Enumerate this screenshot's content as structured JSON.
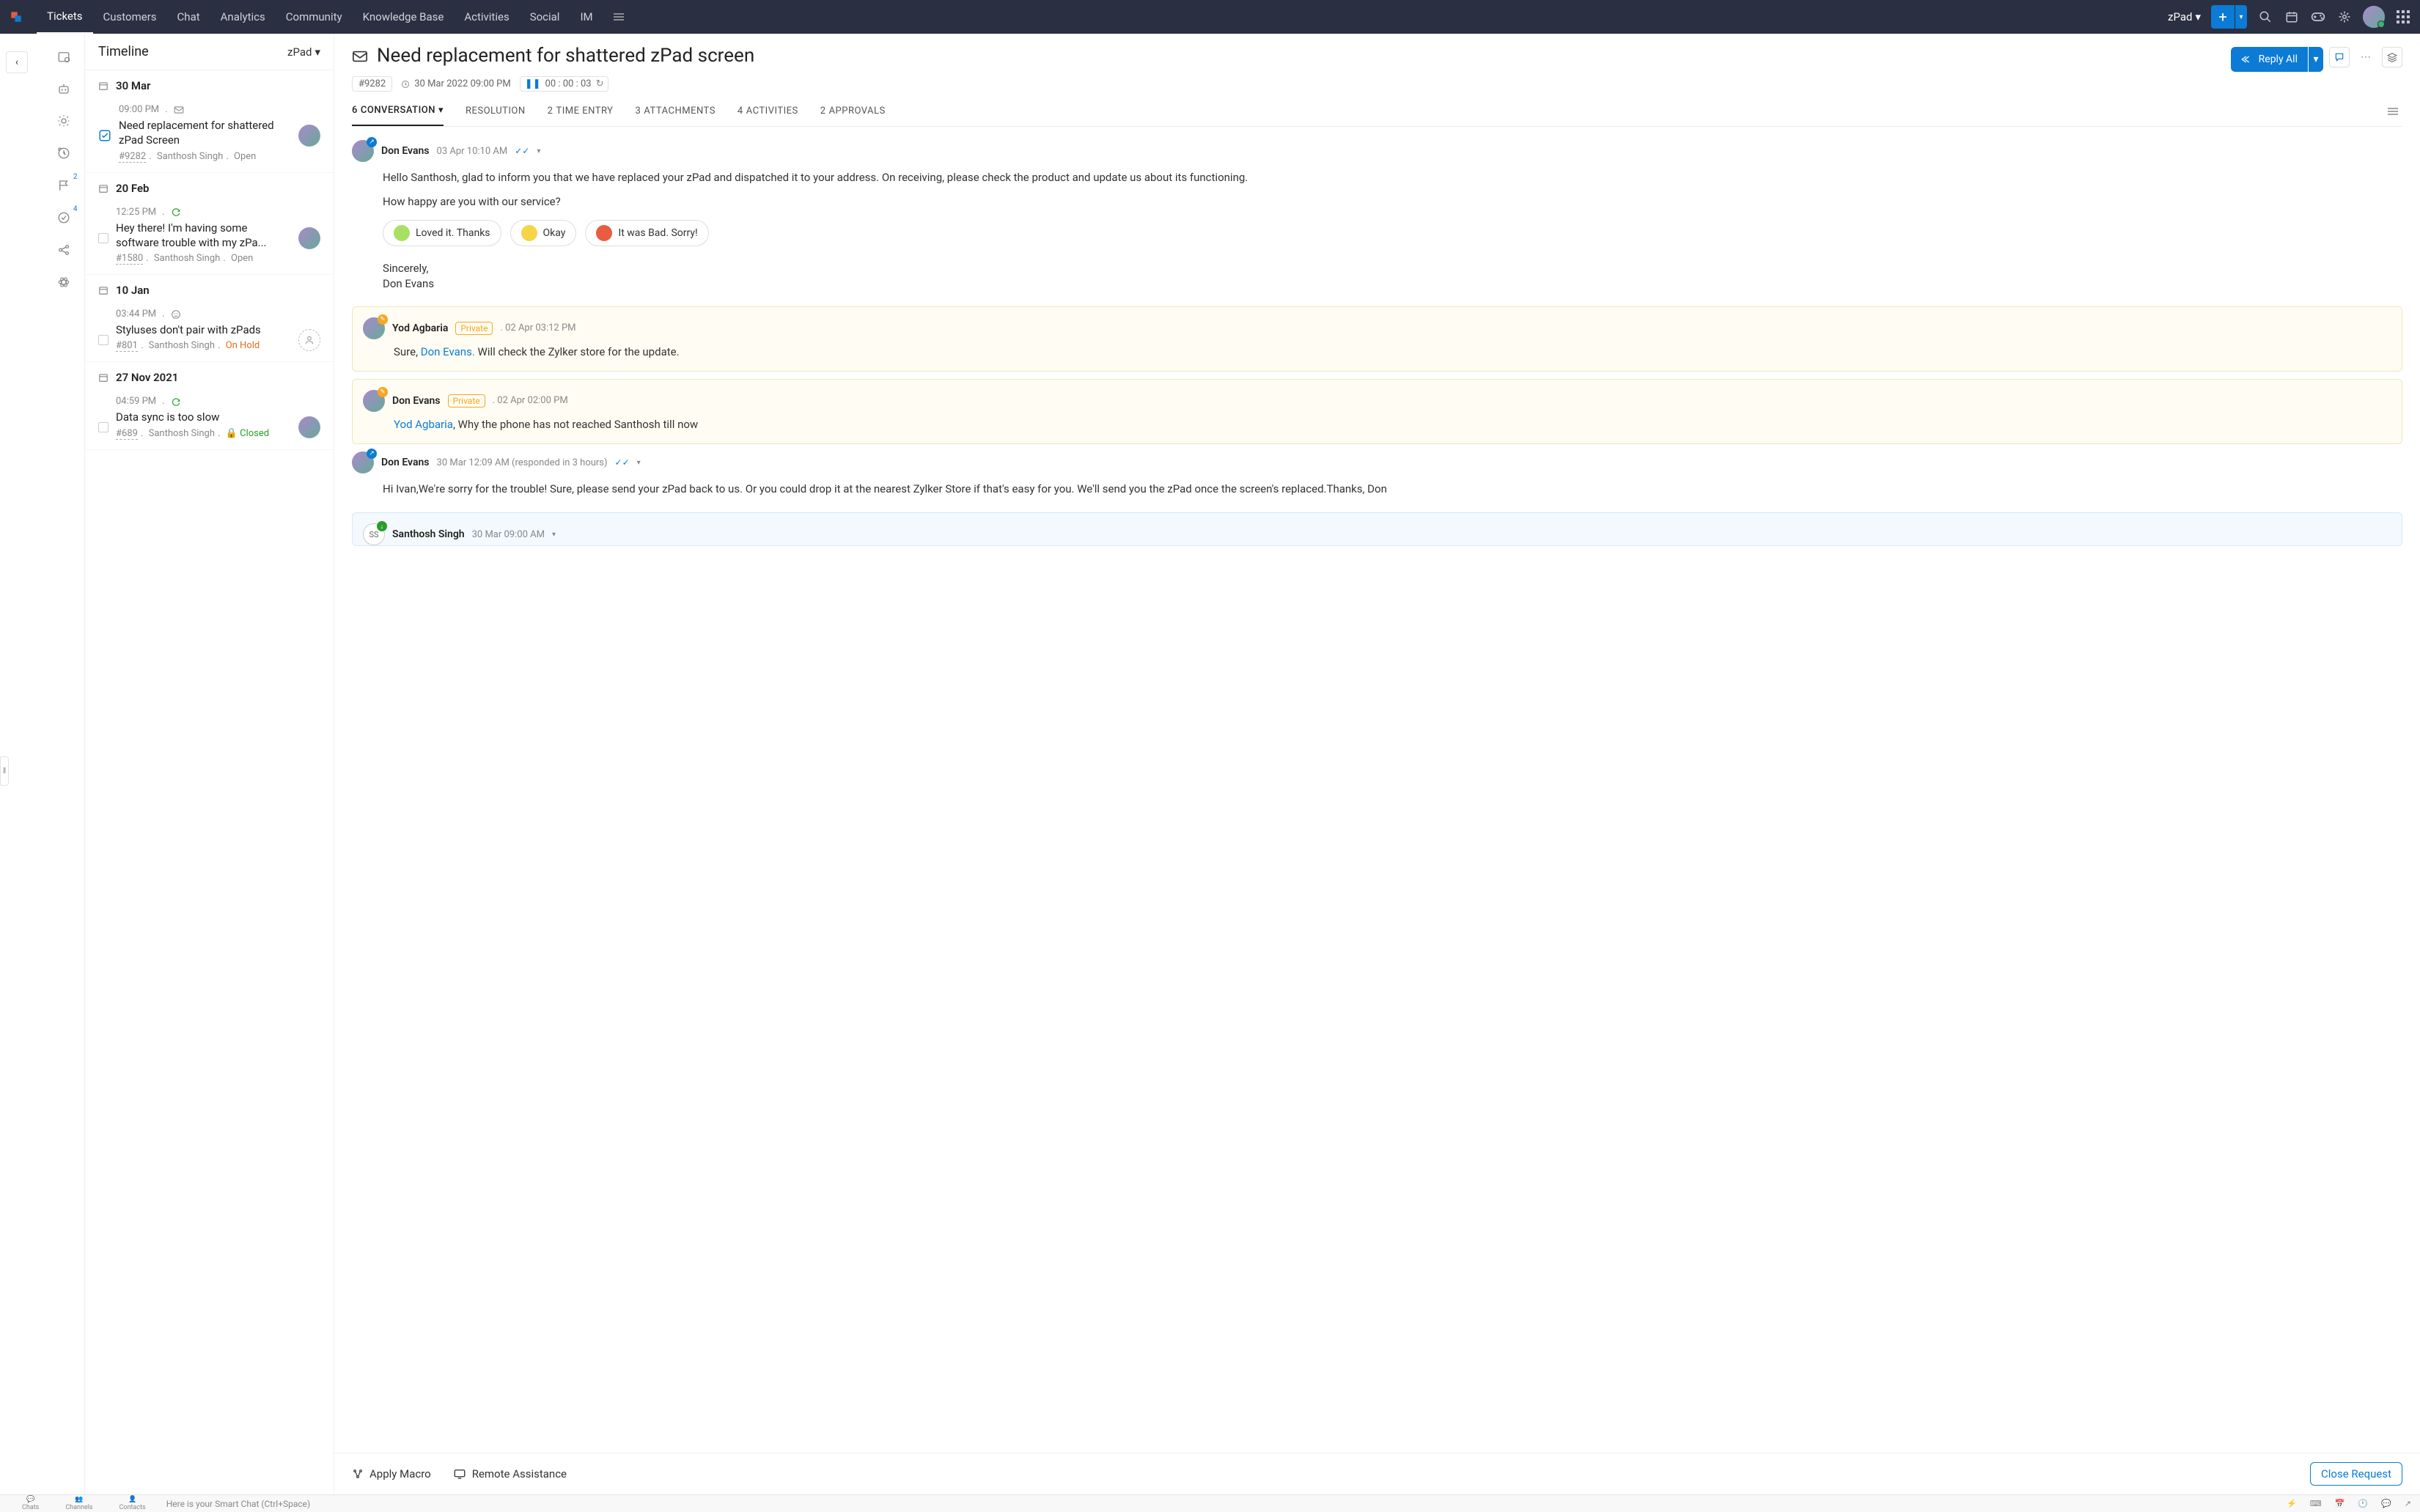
{
  "nav": {
    "items": [
      "Tickets",
      "Customers",
      "Chat",
      "Analytics",
      "Community",
      "Knowledge Base",
      "Activities",
      "Social",
      "IM"
    ],
    "brand": "zPad"
  },
  "timeline": {
    "title": "Timeline",
    "brand": "zPad",
    "groups": [
      {
        "date": "30 Mar",
        "tickets": [
          {
            "time": "09:00 PM",
            "subject": "Need replacement for shattered zPad Screen",
            "id": "#9282",
            "assignee": "Santhosh Singh",
            "status": "Open",
            "selected": true,
            "hasAvatar": true
          }
        ]
      },
      {
        "date": "20 Feb",
        "tickets": [
          {
            "time": "12:25 PM",
            "subject": "Hey there! I'm having some software trouble with my zPa...",
            "id": "#1580",
            "assignee": "Santhosh Singh",
            "status": "Open",
            "hasAvatar": true
          }
        ]
      },
      {
        "date": "10 Jan",
        "tickets": [
          {
            "time": "03:44 PM",
            "subject": "Styluses don't pair with zPads",
            "id": "#801",
            "assignee": "Santhosh Singh",
            "status": "On Hold",
            "statusClass": "onhold",
            "hasAvatar": false
          }
        ]
      },
      {
        "date": "27 Nov 2021",
        "tickets": [
          {
            "time": "04:59 PM",
            "subject": "Data sync is too slow",
            "id": "#689",
            "assignee": "Santhosh Singh",
            "status": "Closed",
            "statusClass": "closed",
            "closedIcon": true,
            "hasAvatar": true
          }
        ]
      }
    ]
  },
  "iconrail": {
    "badge1": "2",
    "badge2": "4"
  },
  "ticket": {
    "title": "Need replacement for shattered zPad screen",
    "id": "#9282",
    "date": "30 Mar 2022 09:00 PM",
    "timer": "00 : 00 : 03",
    "replyAll": "Reply All",
    "tabs": [
      {
        "count": "6",
        "label": "CONVERSATION",
        "active": true,
        "drop": true
      },
      {
        "count": "",
        "label": "RESOLUTION"
      },
      {
        "count": "2",
        "label": "TIME ENTRY"
      },
      {
        "count": "3",
        "label": "ATTACHMENTS"
      },
      {
        "count": "4",
        "label": "ACTIVITIES"
      },
      {
        "count": "2",
        "label": "APPROVALS"
      }
    ]
  },
  "conv": [
    {
      "id": "m1",
      "author": "Don Evans",
      "time": "03 Apr 10:10 AM",
      "ticks": true,
      "badge": "send",
      "body": "Hello Santhosh, glad to inform you that we have replaced your zPad and dispatched it to your address. On receiving, please check the product and update us about its functioning.",
      "survey_q": "How happy are you with our service?",
      "survey_opt1": "Loved it. Thanks",
      "survey_opt2": "Okay",
      "survey_opt3": "It was Bad. Sorry!",
      "sign1": "Sincerely,",
      "sign2": "Don Evans"
    },
    {
      "id": "m2",
      "type": "private",
      "author": "Yod Agbaria",
      "badge_label": "Private",
      "time": "02(sep)02 Apr 03:12 PM",
      "time_display": "02 Apr 03:12 PM",
      "badge": "priv",
      "prefix": "Sure, ",
      "mention": "Don Evans.",
      "rest": " Will check the Zylker store for the update."
    },
    {
      "id": "m3",
      "type": "private",
      "author": "Don Evans",
      "badge_label": "Private",
      "time_display": "02 Apr 02:00 PM",
      "badge": "priv",
      "mention": "Yod Agbaria",
      "rest": ",  Why the phone has not reached Santhosh till now"
    },
    {
      "id": "m4",
      "author": "Don Evans",
      "time": "30 Mar 12:09 AM (responded in 3 hours)",
      "ticks": true,
      "badge": "send",
      "body": "Hi Ivan,We're sorry for the trouble! Sure, please send your zPad back to us. Or you could drop it at the nearest Zylker Store if that's easy for you. We'll send you the zPad once the screen's replaced.Thanks, Don"
    },
    {
      "id": "m5",
      "type": "incoming",
      "author": "Santhosh Singh",
      "time": "30 Mar 09:00 AM",
      "badge": "recv",
      "initials": "SS"
    }
  ],
  "footer_actions": {
    "macro": "Apply Macro",
    "remote": "Remote Assistance",
    "close": "Close Request"
  },
  "footer": {
    "tabs": [
      "Chats",
      "Channels",
      "Contacts"
    ],
    "smart": "Here is your Smart Chat (Ctrl+Space)"
  }
}
